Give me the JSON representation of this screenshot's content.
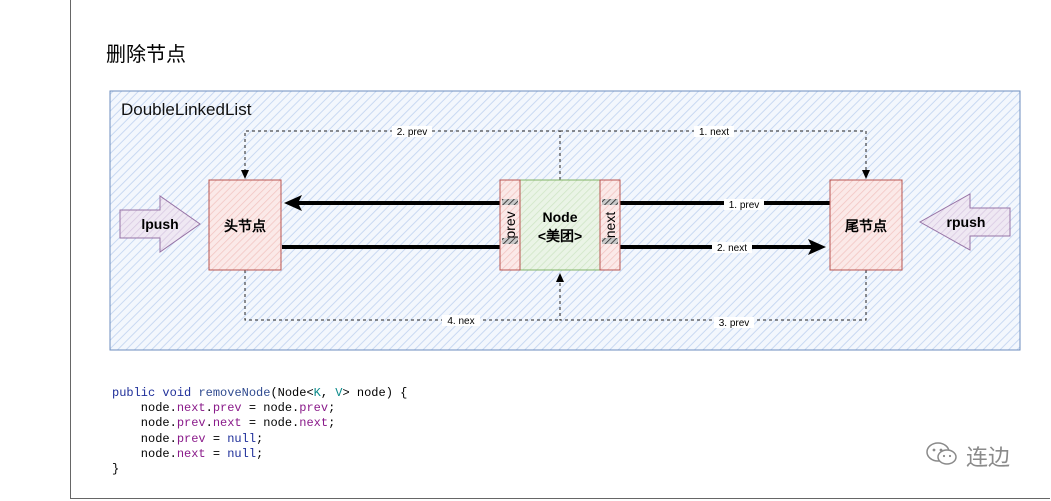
{
  "page_title": "删除节点",
  "panel_title": "DoubleLinkedList",
  "nodes": {
    "head": "头节点",
    "tail": "尾节点",
    "node_line1": "Node",
    "node_line2": "<美团>",
    "prev_field": "prev",
    "next_field": "next"
  },
  "arrows": {
    "lpush": "lpush",
    "rpush": "rpush"
  },
  "edge_labels": {
    "top_left": "2. prev",
    "top_right": "1. next",
    "mid_top": "1. prev",
    "mid_bottom": "2. next",
    "bottom_left": "4. nex",
    "bottom_right": "3. prev"
  },
  "code": {
    "l1_kw1": "public",
    "l1_kw2": "void",
    "l1_fn": "removeNode",
    "l1_a": "(Node<",
    "l1_k": "K",
    "l1_b": ", ",
    "l1_v": "V",
    "l1_c": "> node) {",
    "l2_a": "    node.",
    "l2_f1": "next",
    "l2_b": ".",
    "l2_f2": "prev",
    "l2_c": " = node.",
    "l2_f3": "prev",
    "l2_d": ";",
    "l3_a": "    node.",
    "l3_f1": "prev",
    "l3_b": ".",
    "l3_f2": "next",
    "l3_c": " = node.",
    "l3_f3": "next",
    "l3_d": ";",
    "l4_a": "    node.",
    "l4_f1": "prev",
    "l4_b": " = ",
    "l4_n": "null",
    "l4_d": ";",
    "l5_a": "    node.",
    "l5_f1": "next",
    "l5_b": " = ",
    "l5_n": "null",
    "l5_d": ";",
    "l6": "}"
  },
  "watermark": "连边",
  "colors": {
    "panel_border": "#6c8ebf",
    "panel_fill": "#dae8fc",
    "node_red": "#b85450",
    "node_red_fill": "#f8cecc",
    "node_green": "#82b366",
    "node_green_fill": "#d5e8d4",
    "push_arrow": "#9673a6",
    "push_fill": "#e1d5e7"
  }
}
